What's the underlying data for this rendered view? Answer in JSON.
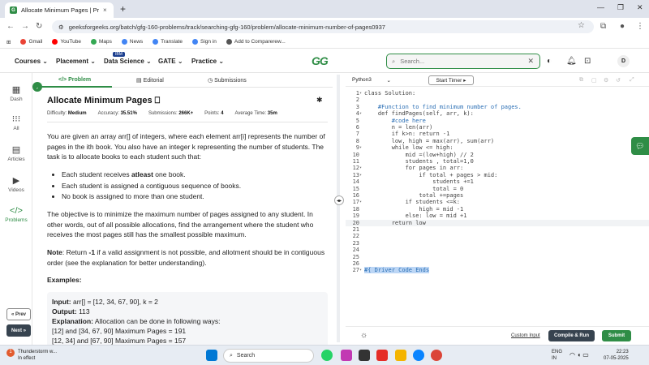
{
  "browser": {
    "tab_title": "Allocate Minimum Pages | Prac",
    "tab_close": "×",
    "new_tab": "+",
    "url": "geeksforgeeks.org/batch/gfg-160-problems/track/searching-gfg-160/problem/allocate-minimum-number-of-pages0937",
    "bookmarks": [
      {
        "label": "Gmail",
        "color": "#ea4335"
      },
      {
        "label": "YouTube",
        "color": "#ff0000"
      },
      {
        "label": "Maps",
        "color": "#34a853"
      },
      {
        "label": "News",
        "color": "#4285f4"
      },
      {
        "label": "Translate",
        "color": "#4285f4"
      },
      {
        "label": "Sign in",
        "color": "#4285f4"
      },
      {
        "label": "Add to Comparerew...",
        "color": "#555555"
      }
    ]
  },
  "header": {
    "menus": [
      "Courses",
      "Placement",
      "Data Science",
      "GATE",
      "Practice"
    ],
    "ibm_badge": "IBM",
    "logo": "GG",
    "search_placeholder": "Search...",
    "avatar": "D"
  },
  "sidebar": {
    "items": [
      {
        "label": "Dash",
        "icon": "grid-icon"
      },
      {
        "label": "All",
        "icon": "apps-icon"
      },
      {
        "label": "Articles",
        "icon": "article-icon"
      },
      {
        "label": "Videos",
        "icon": "video-icon"
      },
      {
        "label": "Problems",
        "icon": "code-icon"
      }
    ],
    "prev_label": "« Prev",
    "next_label": "Next »"
  },
  "problem": {
    "tabs": [
      "Problem",
      "Editorial",
      "Submissions"
    ],
    "title": "Allocate Minimum Pages",
    "meta": {
      "difficulty_label": "Difficulty:",
      "difficulty": "Medium",
      "accuracy_label": "Accuracy:",
      "accuracy": "35.51%",
      "submissions_label": "Submissions:",
      "submissions": "266K+",
      "points_label": "Points:",
      "points": "4",
      "time_label": "Average Time:",
      "time": "35m"
    },
    "intro": "You are given an array arr[] of integers, where each element arr[i] represents the number of pages in the ith book. You also have an integer k representing the number of students. The task is to allocate books to each student such that:",
    "bullets": [
      {
        "pre": "Each student receives ",
        "bold": "atleast",
        "post": " one book."
      },
      {
        "pre": "Each student is assigned a contiguous sequence of books.",
        "bold": "",
        "post": ""
      },
      {
        "pre": "No book is assigned to more than one student.",
        "bold": "",
        "post": ""
      }
    ],
    "objective": "The objective is to minimize the maximum number of pages assigned to any student. In other words, out of all possible allocations, find the arrangement where the student who receives the most pages still has the smallest possible maximum.",
    "note_label": "Note",
    "note_pre": ": Return ",
    "note_bold": "-1",
    "note_post": " if a valid assignment is not possible, and allotment should be in contiguous order (see the explanation for better understanding).",
    "examples_label": "Examples:",
    "example": {
      "input_label": "Input:",
      "input": "arr[] = [12, 34, 67, 90], k = 2",
      "output_label": "Output:",
      "output": "113",
      "explanation_label": "Explanation:",
      "explanation": "Allocation can be done in following ways:",
      "line1": "[12] and [34, 67, 90] Maximum Pages = 191",
      "line2": "[12, 34] and [67, 90] Maximum Pages = 157"
    }
  },
  "editor": {
    "language": "Python3",
    "timer_label": "Start Timer",
    "lines": [
      "class Solution:",
      "",
      "    #Function to find minimum number of pages.",
      "    def findPages(self, arr, k):",
      "        #code here",
      "        n = len(arr)",
      "        if k>n: return -1",
      "        low, high = max(arr), sum(arr)",
      "        while low <= high:",
      "            mid =(low+high) // 2",
      "            students , total=1,0",
      "            for pages in arr:",
      "                if total + pages > mid:",
      "                    students +=1",
      "                    total = 0",
      "                total +=pages",
      "            if students <=k:",
      "                high = mid -1",
      "            else: low = mid +1",
      "        return low",
      "",
      "",
      "",
      "",
      "",
      "",
      "#{ Driver Code Ends"
    ],
    "fold_lines": [
      1,
      4,
      9,
      12,
      13,
      17,
      27
    ],
    "custom_input": "Custom Input",
    "compile_label": "Compile & Run",
    "submit_label": "Submit"
  },
  "taskbar": {
    "weather_title": "Thunderstorm w...",
    "weather_sub": "In effect",
    "weather_badge": "1",
    "search": "Search",
    "lang1": "ENG",
    "lang2": "IN",
    "time": "22:23",
    "date": "07-05-2025"
  }
}
